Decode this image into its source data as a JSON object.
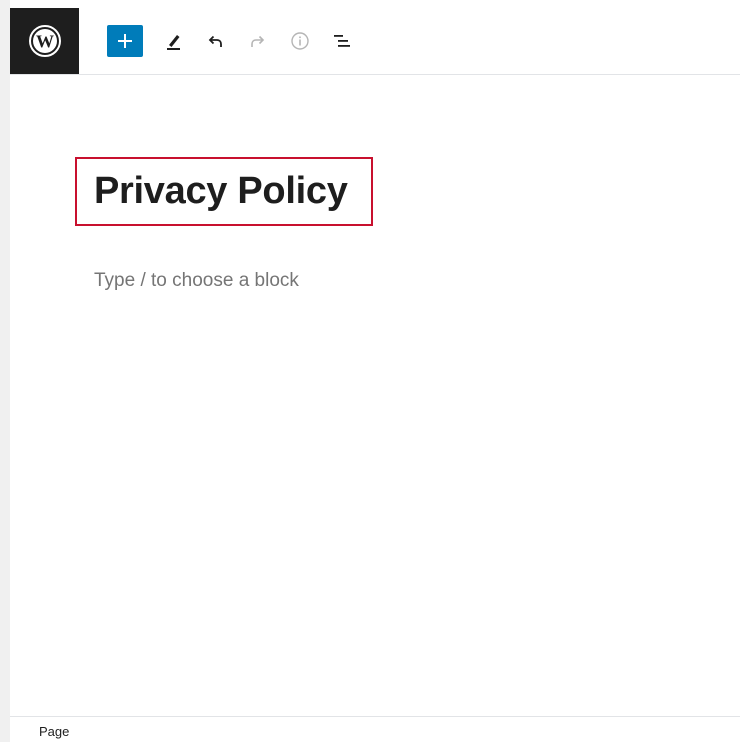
{
  "toolbar": {
    "logo_icon": "wordpress-logo-icon",
    "add_block_icon": "plus-icon",
    "tools_icon": "pencil-icon",
    "undo_icon": "undo-icon",
    "redo_icon": "redo-icon",
    "details_icon": "info-icon",
    "list_view_icon": "list-view-icon",
    "accent_color": "#007cba"
  },
  "editor": {
    "title": "Privacy Policy",
    "block_placeholder": "Type / to choose a block",
    "highlight_color": "#c8102e"
  },
  "footer": {
    "breadcrumb": "Page"
  }
}
